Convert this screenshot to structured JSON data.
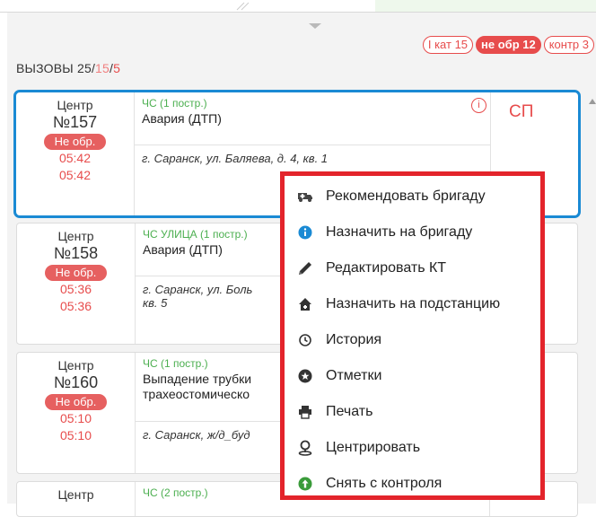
{
  "chips": [
    {
      "label": "I кат 15",
      "filled": false
    },
    {
      "label": "не обр 12",
      "filled": true
    },
    {
      "label": "контр 3",
      "filled": false
    }
  ],
  "header": {
    "prefix": "ВЫЗОВЫ ",
    "total": "25",
    "sep1": "/",
    "unprocessed": "15",
    "sep2": "/",
    "controlled": "5"
  },
  "cards": [
    {
      "station": "Центр",
      "number": "№157",
      "status": "Не обр.",
      "time1": "05:42",
      "time2": "05:42",
      "type": "ЧС (1 постр.)",
      "description": "Авария (ДТП)",
      "address": "г. Саранск, ул. Баляева, д. 4, кв. 1",
      "code": "СП"
    },
    {
      "station": "Центр",
      "number": "№158",
      "status": "Не обр.",
      "time1": "05:36",
      "time2": "05:36",
      "type": "ЧС УЛИЦА (1 постр.)",
      "description": "Авария (ДТП)",
      "address": "г. Саранск, ул. Боль",
      "address2": "кв. 5",
      "code": ""
    },
    {
      "station": "Центр",
      "number": "№160",
      "status": "Не обр.",
      "time1": "05:10",
      "time2": "05:10",
      "type": "ЧС (1 постр.)",
      "description": "Выпадение трубки",
      "description2": "трахеостомическо",
      "address": "г. Саранск, ж/д_буд",
      "code": ""
    },
    {
      "station": "Центр",
      "type": "ЧС (2 постр.)"
    }
  ],
  "context_menu": {
    "items": [
      {
        "label": "Рекомендовать бригаду",
        "icon": "ambulance-icon"
      },
      {
        "label": "Назначить на бригаду",
        "icon": "info-icon"
      },
      {
        "label": "Редактировать КТ",
        "icon": "pencil-icon"
      },
      {
        "label": "Назначить на подстанцию",
        "icon": "home-icon"
      },
      {
        "label": "История",
        "icon": "history-icon"
      },
      {
        "label": "Отметки",
        "icon": "star-icon"
      },
      {
        "label": "Печать",
        "icon": "print-icon"
      },
      {
        "label": "Центрировать",
        "icon": "map-pin-icon"
      },
      {
        "label": "Снять с контроля",
        "icon": "arrow-up-icon"
      }
    ],
    "colors": {
      "border": "#e3242b",
      "info": "#1a8ad4",
      "arrow": "#3a9b3a"
    }
  },
  "colors": {
    "accent": "#1a8ad4",
    "alert": "#e74c4c",
    "type_green": "#4caf50"
  }
}
